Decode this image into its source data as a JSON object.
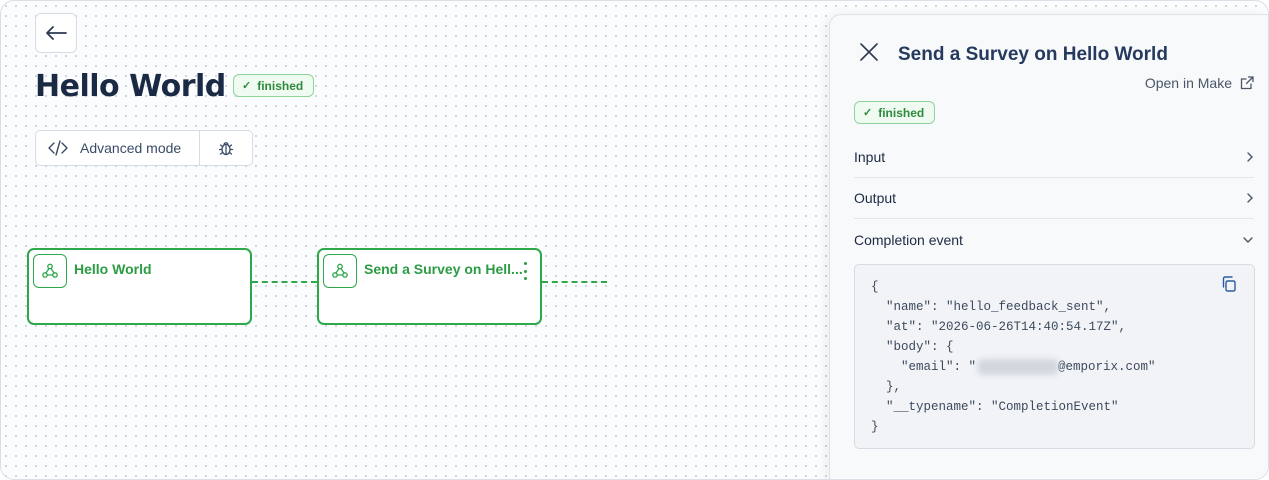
{
  "header": {
    "title": "Hello World",
    "status": "finished",
    "advanced_mode_label": "Advanced mode"
  },
  "workflow": {
    "nodes": [
      {
        "title": "Hello World"
      },
      {
        "title": "Send a Survey on Hell..."
      }
    ]
  },
  "panel": {
    "title": "Send a Survey on Hello World",
    "open_link": "Open in Make",
    "status": "finished",
    "sections": {
      "input": "Input",
      "output": "Output",
      "completion": "Completion event"
    },
    "code": {
      "line1": "{",
      "line2": "  \"name\": \"hello_feedback_sent\",",
      "line3": "  \"at\": \"2026-06-26T14:40:54.17Z\",",
      "line4": "  \"body\": {",
      "line5_prefix": "    \"email\": \"",
      "line5_suffix": "@emporix.com\"",
      "line6": "  },",
      "line7": "  \"__typename\": \"CompletionEvent\"",
      "line8": "}"
    }
  },
  "colors": {
    "success": "#2da84a",
    "title": "#1b2a44"
  }
}
